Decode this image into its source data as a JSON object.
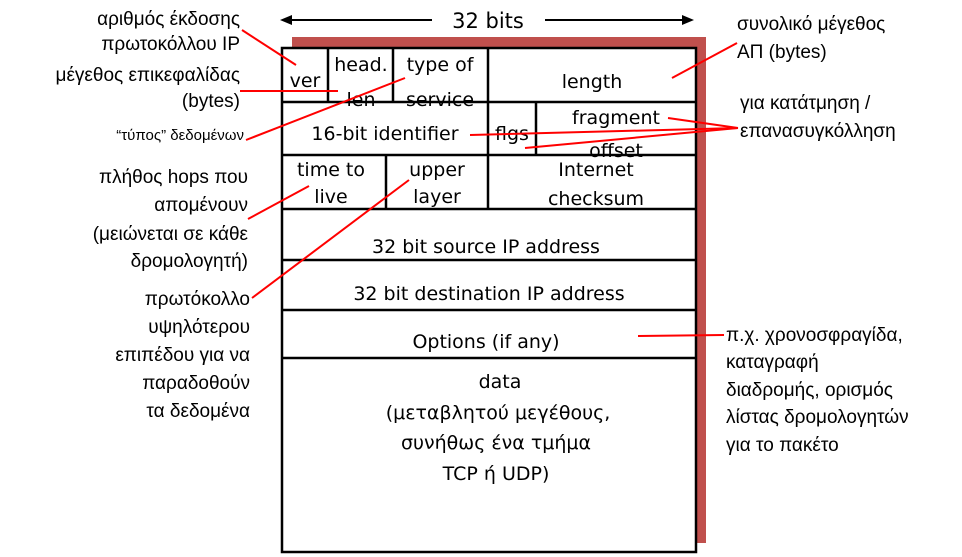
{
  "title": "32 bits",
  "colors": {
    "shadow": "#c0504d",
    "leader": "#ff0000",
    "grid": "#000000"
  },
  "header_rows": [
    {
      "fields": [
        {
          "id": "ver",
          "lines": [
            "ver"
          ]
        },
        {
          "id": "head-len",
          "lines": [
            "head.",
            "len"
          ]
        },
        {
          "id": "type-of-service",
          "lines": [
            "type of",
            "service"
          ]
        },
        {
          "id": "length",
          "lines": [
            "length"
          ]
        }
      ]
    },
    {
      "fields": [
        {
          "id": "identifier",
          "lines": [
            "16-bit identifier"
          ]
        },
        {
          "id": "flags",
          "lines": [
            "flgs"
          ]
        },
        {
          "id": "fragment-offset",
          "lines": [
            "fragment",
            "offset"
          ]
        }
      ]
    },
    {
      "fields": [
        {
          "id": "ttl",
          "lines": [
            "time to",
            "live"
          ]
        },
        {
          "id": "upper-layer",
          "lines": [
            "upper",
            "layer"
          ]
        },
        {
          "id": "checksum",
          "lines": [
            "Internet",
            "checksum"
          ]
        }
      ]
    },
    {
      "fields": [
        {
          "id": "source-ip",
          "lines": [
            "32 bit source IP address"
          ]
        }
      ]
    },
    {
      "fields": [
        {
          "id": "destination-ip",
          "lines": [
            "32 bit destination IP address"
          ]
        }
      ]
    },
    {
      "fields": [
        {
          "id": "options",
          "lines": [
            "Options (if any)"
          ]
        }
      ]
    },
    {
      "fields": [
        {
          "id": "data",
          "lines": [
            "data",
            "(μεταβλητού μεγέθους,",
            "συνήθως ένα τμήμα",
            "TCP ή UDP)"
          ]
        }
      ]
    }
  ],
  "annotations": {
    "version": [
      "αριθμός έκδοσης",
      "πρωτοκόλλου IP"
    ],
    "header_length": [
      "μέγεθος επικεφαλίδας",
      "(bytes)"
    ],
    "data_type": [
      "“τύπος” δεδομένων"
    ],
    "ttl": [
      "πλήθος hops που",
      "απομένουν",
      "(μειώνεται σε κάθε",
      "δρομολογητή)"
    ],
    "upper_layer": [
      "πρωτόκολλο",
      "υψηλότερου",
      "επιπέδου για να",
      "παραδοθούν",
      "τα δεδομένα"
    ],
    "total_length": [
      "συνολικό μέγεθος",
      "ΑΠ (bytes)"
    ],
    "fragmentation": [
      "για κατάτμηση /",
      "επανασυγκόλληση"
    ],
    "options": [
      "π.χ. χρονοσφραγίδα,",
      "καταγραφή",
      "διαδρομής, ορισμός",
      "λίστας δρομολογητών",
      "για το πακέτο"
    ]
  }
}
